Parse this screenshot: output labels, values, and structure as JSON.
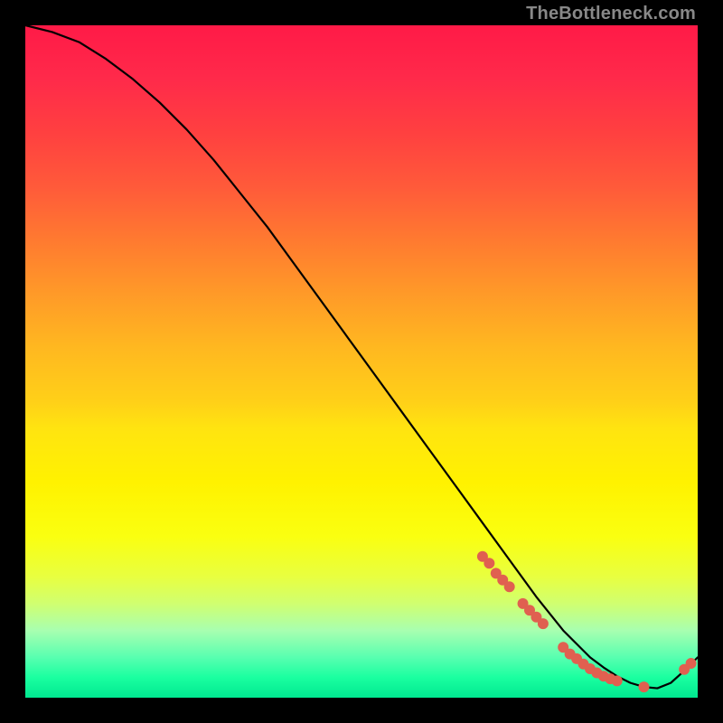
{
  "watermark": "TheBottleneck.com",
  "chart_data": {
    "type": "line",
    "title": "",
    "xlabel": "",
    "ylabel": "",
    "xlim": [
      0,
      100
    ],
    "ylim": [
      0,
      100
    ],
    "grid": false,
    "legend": false,
    "series": [
      {
        "name": "curve",
        "color": "#000000",
        "x": [
          0,
          4,
          8,
          12,
          16,
          20,
          24,
          28,
          32,
          36,
          40,
          44,
          48,
          52,
          56,
          60,
          64,
          68,
          72,
          76,
          80,
          82,
          84,
          86,
          88,
          90,
          92,
          94,
          96,
          98,
          100
        ],
        "y": [
          100,
          99,
          97.5,
          95,
          92,
          88.5,
          84.5,
          80,
          75,
          70,
          64.5,
          59,
          53.5,
          48,
          42.5,
          37,
          31.5,
          26,
          20.5,
          15,
          10,
          8,
          6,
          4.5,
          3.2,
          2.2,
          1.6,
          1.4,
          2.2,
          4.0,
          6.0
        ]
      }
    ],
    "markers": {
      "name": "points",
      "color": "#e06050",
      "radius_px": 6,
      "x": [
        68,
        69,
        70,
        71,
        72,
        74,
        75,
        76,
        77,
        80,
        81,
        82,
        83,
        84,
        85,
        86,
        87,
        88,
        92,
        98,
        99
      ],
      "y": [
        21,
        20,
        18.5,
        17.5,
        16.5,
        14,
        13,
        12,
        11,
        7.5,
        6.5,
        5.8,
        5.0,
        4.3,
        3.7,
        3.2,
        2.8,
        2.5,
        1.6,
        4.2,
        5.1
      ]
    }
  }
}
